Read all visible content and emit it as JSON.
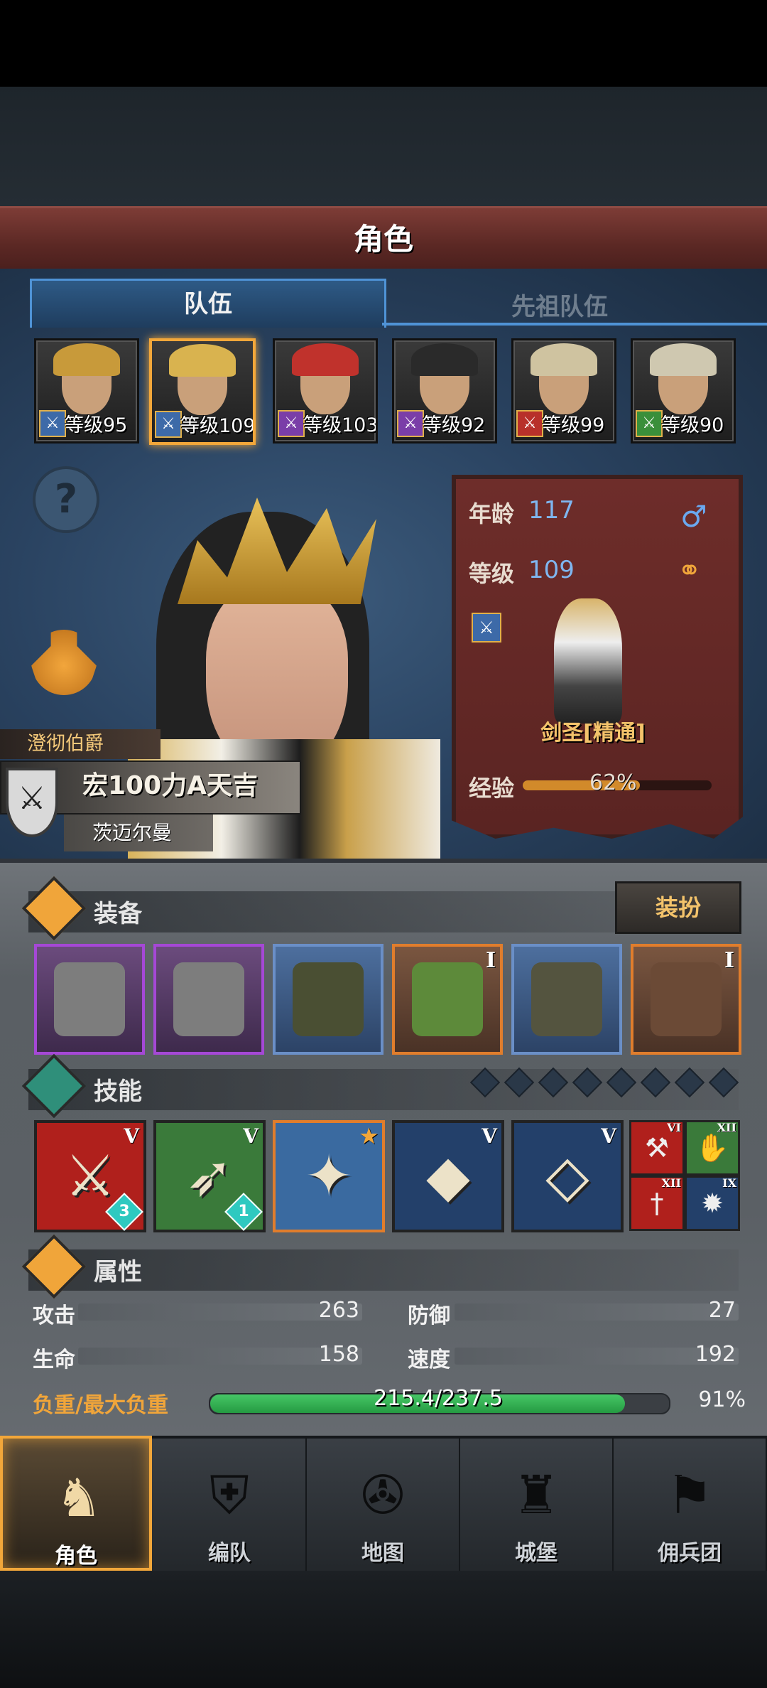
{
  "header": {
    "title": "角色"
  },
  "tabs": [
    {
      "label": "队伍",
      "active": true
    },
    {
      "label": "先祖队伍",
      "active": false
    }
  ],
  "heroes": [
    {
      "level": "等级95",
      "class_icon": "sword-icon",
      "class_color": "#3d6aa8",
      "helm_color": "#c89a3a",
      "selected": false
    },
    {
      "level": "等级109",
      "class_icon": "sword-icon",
      "class_color": "#3d6aa8",
      "helm_color": "#d9b34f",
      "selected": true
    },
    {
      "level": "等级103",
      "class_icon": "staff-icon",
      "class_color": "#7a3ea8",
      "helm_color": "#c0322c",
      "selected": false
    },
    {
      "level": "等级92",
      "class_icon": "staff-icon",
      "class_color": "#7a3ea8",
      "helm_color": "#2a2a2a",
      "selected": false
    },
    {
      "level": "等级99",
      "class_icon": "horse-icon",
      "class_color": "#b8302a",
      "helm_color": "#cfc3a0",
      "selected": false
    },
    {
      "level": "等级90",
      "class_icon": "bow-icon",
      "class_color": "#3a8f3a",
      "helm_color": "#cfc8b0",
      "selected": false
    }
  ],
  "character": {
    "rank": "澄彻伯爵",
    "name": "宏100力A天吉",
    "guild": "茨迈尔曼",
    "age_label": "年龄",
    "age": "117",
    "level_label": "等级",
    "level": "109",
    "class_name": "剑圣[精通]",
    "xp_label": "经验",
    "xp_text": "62%",
    "xp_fraction": 0.62
  },
  "equipment": {
    "title": "装备",
    "dress_button": "装扮",
    "items": [
      {
        "rarity": "epic",
        "badge": "",
        "icon": "warhammer-icon",
        "color": "#7d7d7d"
      },
      {
        "rarity": "epic",
        "badge": "",
        "icon": "warhammer-icon",
        "color": "#7d7d7d"
      },
      {
        "rarity": "rare",
        "badge": "",
        "icon": "hood-icon",
        "color": "#4a4f33"
      },
      {
        "rarity": "legend",
        "badge": "I",
        "icon": "armor-icon",
        "color": "#5d8a3a"
      },
      {
        "rarity": "rare",
        "badge": "",
        "icon": "boots-icon",
        "color": "#54543f"
      },
      {
        "rarity": "legend",
        "badge": "I",
        "icon": "tome-icon",
        "color": "#6b4a36"
      }
    ]
  },
  "skills": {
    "title": "技能",
    "items": [
      {
        "badge": "V",
        "bg": "#b0201c",
        "glyph": "⚔",
        "level": "3",
        "icon": "sword-strike-icon",
        "border": "#222"
      },
      {
        "badge": "V",
        "bg": "#3a7a3a",
        "glyph": "➶",
        "level": "1",
        "icon": "arrow-volley-icon",
        "border": "#222"
      },
      {
        "badge": "★",
        "bg": "#3a6aa0",
        "glyph": "✦",
        "level": "",
        "icon": "blade-dance-icon",
        "border": "#e07d2c"
      },
      {
        "badge": "V",
        "bg": "#23406a",
        "glyph": "◆",
        "level": "",
        "icon": "crystal-sword-icon",
        "border": "#222"
      },
      {
        "badge": "V",
        "bg": "#23406a",
        "glyph": "◇",
        "level": "",
        "icon": "crystal-wave-icon",
        "border": "#222"
      }
    ],
    "passives": [
      {
        "badge": "VI",
        "bg": "#b0201c",
        "glyph": "⚒",
        "icon": "dumbbell-icon"
      },
      {
        "badge": "XII",
        "bg": "#3a7a3a",
        "glyph": "✋",
        "icon": "fist-icon"
      },
      {
        "badge": "XII",
        "bg": "#b0201c",
        "glyph": "†",
        "icon": "dagger-icon"
      },
      {
        "badge": "IX",
        "bg": "#23406a",
        "glyph": "✹",
        "icon": "burst-icon"
      }
    ]
  },
  "attributes": {
    "title": "属性",
    "attack_label": "攻击",
    "attack": "263",
    "defense_label": "防御",
    "defense": "27",
    "hp_label": "生命",
    "hp": "158",
    "speed_label": "速度",
    "speed": "192",
    "load_label": "负重/最大负重",
    "load_text": "215.4/237.5",
    "load_pct": "91%",
    "load_fraction": 0.91
  },
  "nav": [
    {
      "label": "角色",
      "icon": "knight-icon",
      "glyph": "♞",
      "active": true
    },
    {
      "label": "编队",
      "icon": "helmet-icon",
      "glyph": "⛨",
      "active": false
    },
    {
      "label": "地图",
      "icon": "compass-icon",
      "glyph": "✇",
      "active": false
    },
    {
      "label": "城堡",
      "icon": "castle-icon",
      "glyph": "♜",
      "active": false
    },
    {
      "label": "佣兵团",
      "icon": "banner-icon",
      "glyph": "⚑",
      "active": false
    }
  ],
  "colors": {
    "accent": "#f2a73a",
    "tab_blue": "#4f93d6",
    "banner_red": "#6e2d2a",
    "load_green": "#46c766"
  }
}
